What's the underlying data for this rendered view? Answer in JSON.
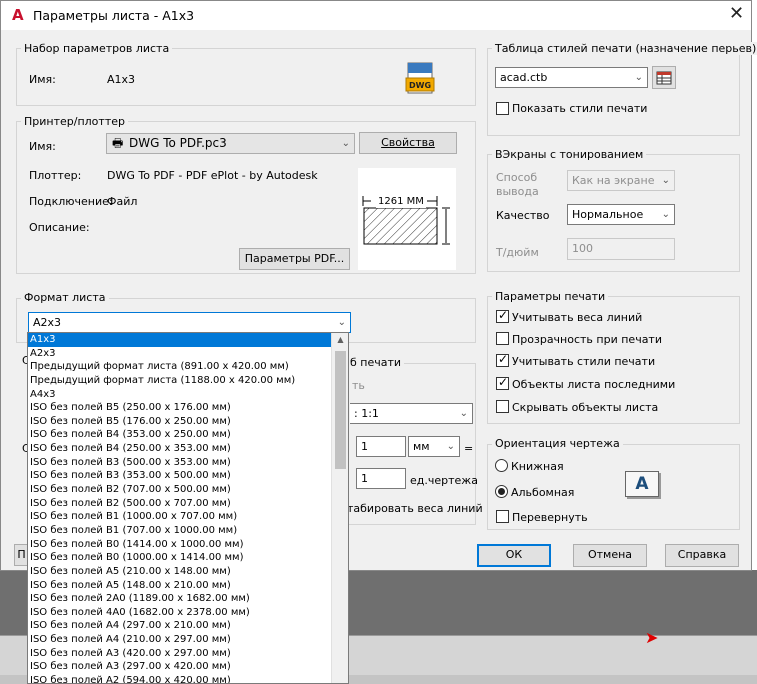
{
  "window": {
    "title": "Параметры листа - A1x3",
    "close": "✕",
    "app_icon": "autocad-logo-icon"
  },
  "page_setup": {
    "group_label": "Набор параметров листа",
    "name_label": "Имя:",
    "name_value": "A1x3",
    "icon": "dwg-file-icon",
    "icon_text": "DWG"
  },
  "printer": {
    "group_label": "Принтер/плоттер",
    "name_label": "Имя:",
    "selected": "DWG To PDF.pc3",
    "properties_button": "Свойства",
    "plotter_label": "Плоттер:",
    "plotter_value": "DWG To PDF - PDF ePlot - by Autodesk",
    "connection_label": "Подключение:",
    "connection_value": "Файл",
    "description_label": "Описание:",
    "pdf_params_button": "Параметры PDF...",
    "preview_dimension": "1261 ММ"
  },
  "paper_size": {
    "group_label": "Формат листа",
    "selected": "A2x3",
    "options": [
      "A1x3",
      "A2x3",
      "Предыдущий формат листа  (891.00 x 420.00 мм)",
      "Предыдущий формат листа  (1188.00 x 420.00 мм)",
      "A4x3",
      "ISO без полей B5 (250.00 x 176.00 мм)",
      "ISO без полей B5 (176.00 x 250.00 мм)",
      "ISO без полей B4 (353.00 x 250.00 мм)",
      "ISO без полей B4 (250.00 x 353.00 мм)",
      "ISO без полей B3 (500.00 x 353.00 мм)",
      "ISO без полей B3 (353.00 x 500.00 мм)",
      "ISO без полей B2 (707.00 x 500.00 мм)",
      "ISO без полей B2 (500.00 x 707.00 мм)",
      "ISO без полей B1 (1000.00 x 707.00 мм)",
      "ISO без полей B1 (707.00 x 1000.00 мм)",
      "ISO без полей B0 (1414.00 x 1000.00 мм)",
      "ISO без полей B0 (1000.00 x 1414.00 мм)",
      "ISO без полей A5 (210.00 x 148.00 мм)",
      "ISO без полей A5 (148.00 x 210.00 мм)",
      "ISO без полей 2A0 (1189.00 x 1682.00 мм)",
      "ISO без полей 4A0 (1682.00 x 2378.00 мм)",
      "ISO без полей A4 (297.00 x 210.00 мм)",
      "ISO без полей A4 (210.00 x 297.00 мм)",
      "ISO без полей A3 (420.00 x 297.00 мм)",
      "ISO без полей A3 (297.00 x 420.00 мм)",
      "ISO без полей A2 (594.00 x 420.00 мм)"
    ],
    "highlighted_index": 0
  },
  "obscured": {
    "letter_c1": "С",
    "letter_c2": "С",
    "letter_p": "П",
    "scale_group_tail": "б печати",
    "fit_tail": "ть",
    "scale_value": ": 1:1",
    "value1": "1",
    "unit": "мм",
    "equals": "=",
    "value2": "1",
    "drawing_units": "ед.чертежа",
    "scale_lineweights_tail": "табировать веса линий"
  },
  "plot_style": {
    "group_label": "Таблица стилей печати (назначение перьев)",
    "selected": "acad.ctb",
    "edit_icon": "edit-table-icon",
    "show_styles": "Показать стили печати",
    "show_styles_checked": false
  },
  "shaded": {
    "group_label": "ВЭкраны с тонированием",
    "mode_label": "Способ вывода",
    "mode_value": "Как на экране",
    "quality_label": "Качество",
    "quality_value": "Нормальное",
    "dpi_label": "Т/дюйм",
    "dpi_value": "100"
  },
  "plot_options": {
    "group_label": "Параметры печати",
    "items": [
      {
        "label": "Учитывать веса линий",
        "checked": true
      },
      {
        "label": "Прозрачность при печати",
        "checked": false
      },
      {
        "label": "Учитывать стили печати",
        "checked": true
      },
      {
        "label": "Объекты листа последними",
        "checked": true
      },
      {
        "label": "Скрывать объекты листа",
        "checked": false
      }
    ]
  },
  "orientation": {
    "group_label": "Ориентация чертежа",
    "portrait": "Книжная",
    "landscape": "Альбомная",
    "selected": "landscape",
    "upside_down": "Перевернуть",
    "upside_down_checked": false,
    "icon": "orientation-a-icon",
    "icon_letter": "A"
  },
  "buttons": {
    "ok": "ОК",
    "cancel": "Отмена",
    "help": "Справка"
  },
  "colors": {
    "accent": "#0078d7",
    "dialog_bg": "#f0f0f0",
    "logo_red": "#c8102e",
    "backdrop": "#6f6f6f"
  }
}
